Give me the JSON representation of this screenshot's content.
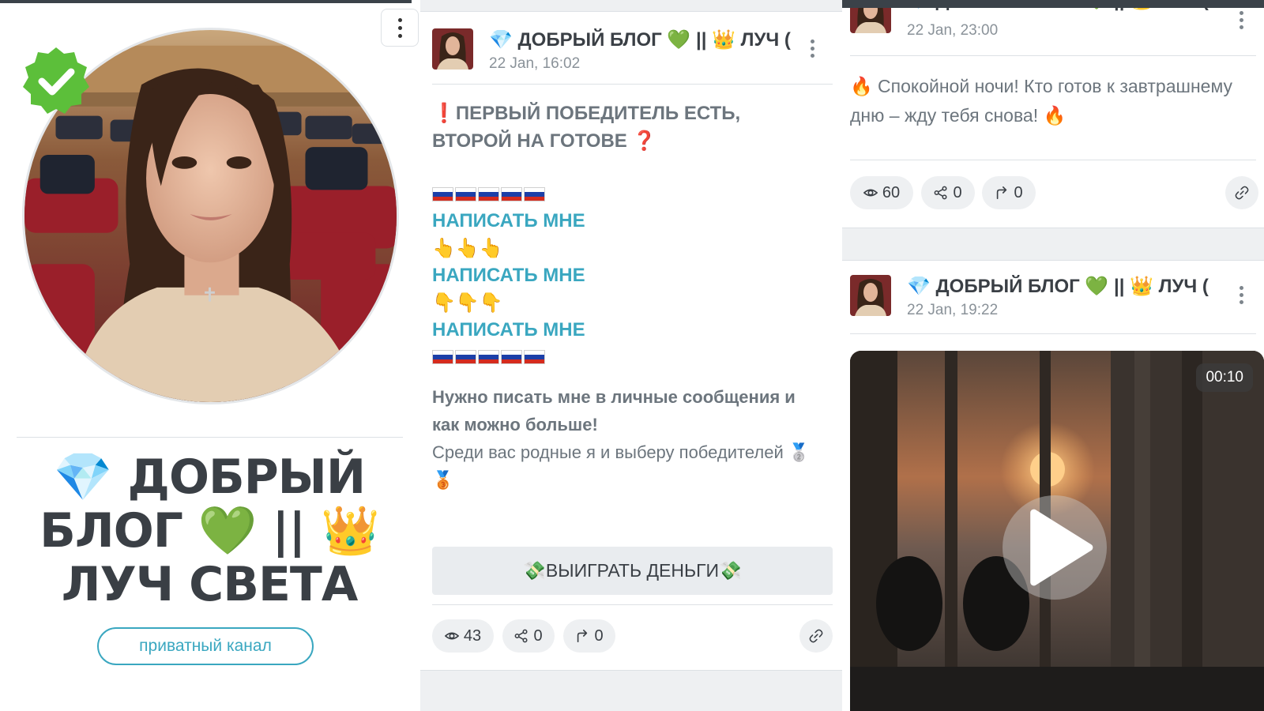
{
  "channel": {
    "title": "💎 ДОБРЫЙ БЛОГ 💚 || 👑 ЛУЧ СВЕТА",
    "badge": "приватный канал"
  },
  "post_main": {
    "author": "💎 ДОБРЫЙ БЛОГ 💚 || 👑 ЛУЧ (",
    "date": "22 Jan, 16:02",
    "headline": "❗ПЕРВЫЙ ПОБЕДИТЕЛЬ ЕСТЬ, ВТОРОЙ НА ГОТОВЕ ❓",
    "link_text_1": "НАПИСАТЬ МНЕ",
    "hands_1": "👆👆👆",
    "link_text_2": "НАПИСАТЬ МНЕ",
    "hands_2": "👇👇👇",
    "link_text_3": "НАПИСАТЬ МНЕ",
    "bold_text": "Нужно писать мне в личные сообщения и как можно больше!",
    "normal_text": "Среди вас родные я и выберу победителей 🥈🥉",
    "button_label": "💸ВЫИГРАТЬ ДЕНЬГИ💸",
    "views": "43",
    "shares": "0",
    "forwards": "0"
  },
  "post_night": {
    "author": "💎 ДОБРЫЙ БЛОГ 💚 || 👑 ЛУЧ (",
    "date": "22 Jan, 23:00",
    "text": "🔥 Спокойной ночи! Кто готов к завтрашнему дню – жду тебя снова! 🔥",
    "views": "60",
    "shares": "0",
    "forwards": "0"
  },
  "post_video": {
    "author": "💎 ДОБРЫЙ БЛОГ 💚 || 👑 ЛУЧ (",
    "date": "22 Jan, 19:22",
    "duration": "00:10"
  },
  "icons": [
    "kebab-icon",
    "verified-badge-icon",
    "eye-icon",
    "share-icon",
    "forward-icon",
    "link-icon",
    "play-icon"
  ],
  "colors": {
    "accent": "#3aa7c0",
    "verified_green": "#5cbf3a",
    "text_dark": "#3a3f45",
    "text_muted": "#6c757d",
    "panel_gray": "#eef0f2"
  }
}
